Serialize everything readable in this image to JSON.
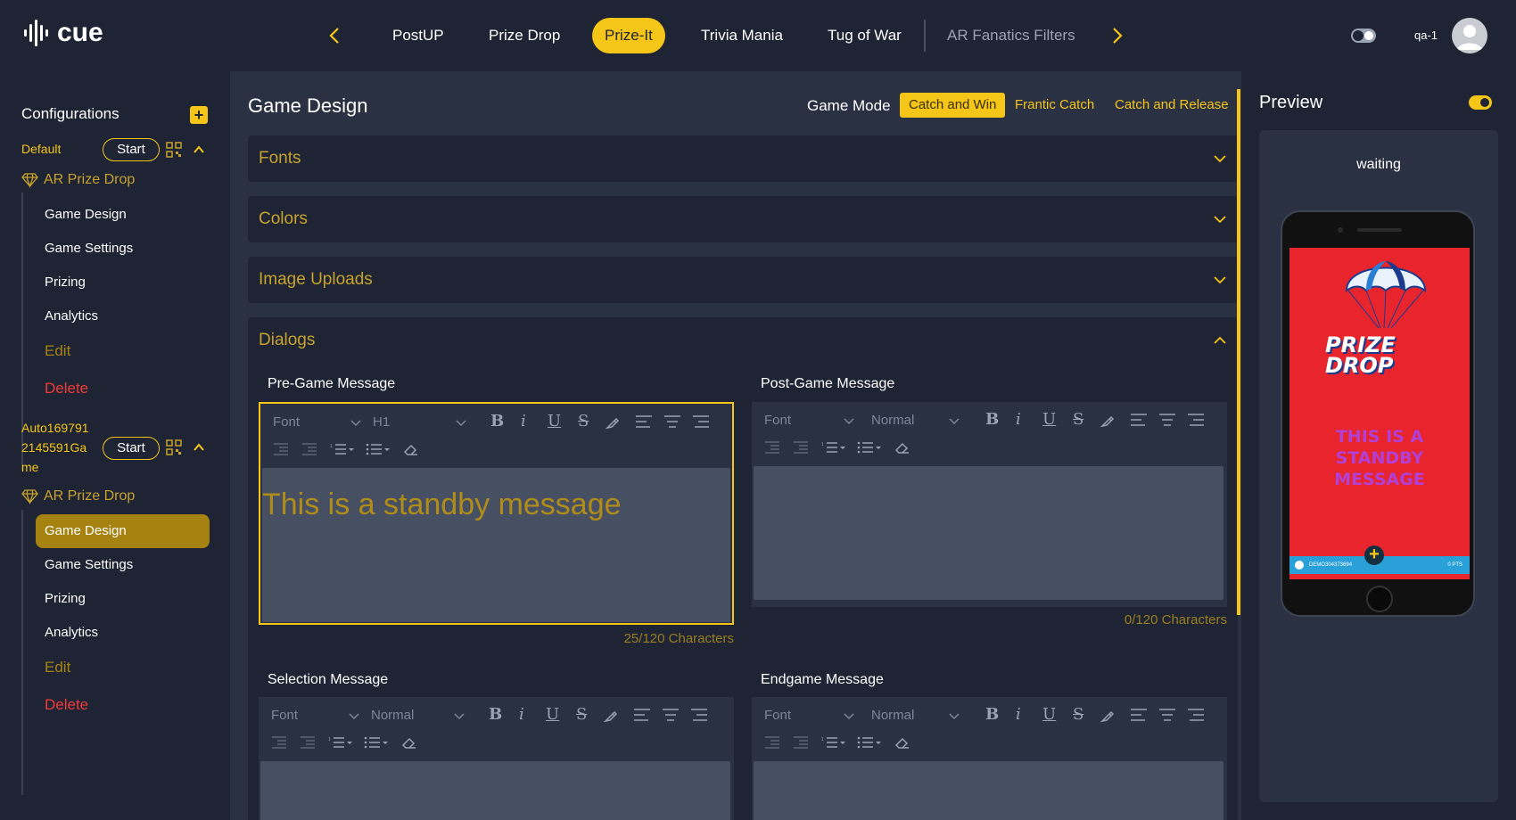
{
  "app": {
    "logo_text": "cue",
    "username": "qa-1"
  },
  "nav": {
    "tabs": [
      {
        "label": "PostUP",
        "active": false
      },
      {
        "label": "Prize Drop",
        "active": false
      },
      {
        "label": "Prize-It",
        "active": true
      },
      {
        "label": "Trivia Mania",
        "active": false
      },
      {
        "label": "Tug of War",
        "active": false
      },
      {
        "label": "AR Fanatics Filters",
        "active": false
      }
    ],
    "prev_icon": "chevron-left-icon",
    "next_icon": "chevron-right-icon"
  },
  "sidebar": {
    "title": "Configurations",
    "configs": [
      {
        "name": "Default",
        "start_label": "Start",
        "game_type": "AR Prize Drop",
        "items": [
          "Game Design",
          "Game Settings",
          "Prizing",
          "Analytics"
        ],
        "edit_label": "Edit",
        "delete_label": "Delete"
      },
      {
        "name_lines": [
          "Auto169791",
          "2145591Ga",
          "me"
        ],
        "start_label": "Start",
        "game_type": "AR Prize Drop",
        "items": [
          "Game Design",
          "Game Settings",
          "Prizing",
          "Analytics"
        ],
        "active_item": "Game Design",
        "edit_label": "Edit",
        "delete_label": "Delete"
      }
    ]
  },
  "main": {
    "title": "Game Design",
    "game_mode_label": "Game Mode",
    "modes": [
      {
        "label": "Catch and Win",
        "active": true
      },
      {
        "label": "Frantic Catch",
        "active": false
      },
      {
        "label": "Catch and Release",
        "active": false
      }
    ],
    "sections": [
      "Fonts",
      "Colors",
      "Image Uploads",
      "Dialogs"
    ],
    "dialogs": {
      "pre_game": {
        "label": "Pre-Game Message",
        "font": "Font",
        "size": "H1",
        "content": "This is a standby message",
        "count": "25/120 Characters"
      },
      "post_game": {
        "label": "Post-Game Message",
        "font": "Font",
        "size": "Normal",
        "count": "0/120 Characters"
      },
      "selection": {
        "label": "Selection Message",
        "font": "Font",
        "size": "Normal"
      },
      "endgame": {
        "label": "Endgame Message",
        "font": "Font",
        "size": "Normal"
      }
    }
  },
  "preview": {
    "title": "Preview",
    "status": "waiting",
    "logo_lines": [
      "PRIZE",
      "DROP"
    ],
    "standby_text": "This is a standby message",
    "footer_left": "DEMO304373694",
    "footer_right": "0 PTS"
  },
  "colors": {
    "accent": "#f5c518",
    "background": "#1e2433",
    "panel": "#293142",
    "danger": "#ef3b3b",
    "preview_screen": "#e8242c"
  }
}
